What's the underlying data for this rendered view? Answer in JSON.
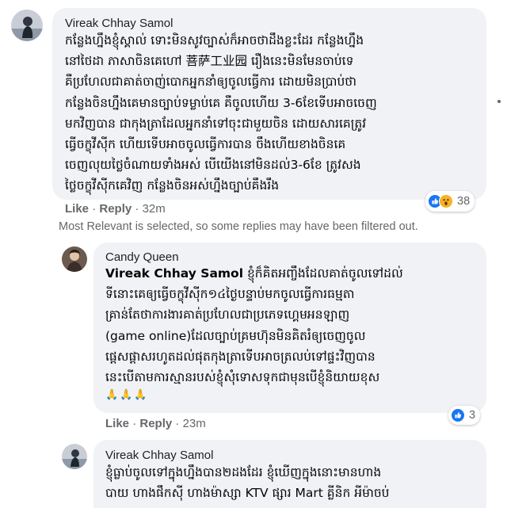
{
  "comments": [
    {
      "author": "Vireak Chhay Samol",
      "lines": [
        "កន្លែងហ្នឹងខ្ញុំស្គាល់ ទោះមិនសូវច្បាស់ក៏អាចថាដឹងខ្លះដែរ កន្លែងហ្នឹង",
        "នៅថៃដា ភាសាចិនគេហៅ 菩萨工业园 រឿងនេះមិនមែនចាប់ទេ",
        "គឺប្រហែលជាគាត់ចាញ់បោកអ្នកនាំឲ្យចូលធ្វើការ ដោយមិនប្រាប់ថា",
        "កន្លែងចិនហ្នឹងគេមានច្បាប់ទម្លាប់គេ គឺចូលហើយ 3-6ខែទើបអាចចេញ",
        "មកវិញបាន ជាកុងត្រាដែលអ្នកនាំទៅចុះជាមួយចិន ដោយសារគេត្រូវ",
        "ធ្វើចក្ខុវីស៊ីក ហើយទើបអាចចូលធ្វើការបាន ចឹងហើយខាងចិនគេ",
        "ចេញលុយថ្លៃចំណាយទាំងអស់ បើយើងនៅមិនដល់3-6ខែ ត្រូវសង",
        "ថ្លៃចក្ខុវីស៊ីកគេវិញ កន្លែងចិនអស់ហ្នឹងច្បាប់គឹងរឹង"
      ],
      "actions": {
        "like": "Like",
        "reply": "Reply",
        "time": "32m"
      },
      "reaction_count": "38",
      "reaction_icons": [
        "like-reaction-icon",
        "wow-reaction-icon"
      ]
    },
    {
      "author": "Candy Queen",
      "mention": "Vireak Chhay Samol",
      "first_line_rest": " ខ្ញុំក៏គិតអញ្ចឹងដែលគាត់ចូលទៅដល់",
      "lines": [
        "ទីនោះគេឲ្យធ្វើចក្ខុវីស៊ីក១៤ថ្ងៃបន្ទាប់មកចូលធ្វើការធម្មតា",
        "គ្រាន់តែថាការងារគាត់ប្រហែលជាប្រភេទហ្គេមអនឡាញ",
        "(game online)ដែលច្បាប់គ្រមហ៊ុនមិនគិតរំឲ្យចេញចូល",
        "ផ្ដេសផ្ដាសរហូតដល់ផុតកុងត្រាទើបអាចត្រលប់ទៅផ្ទះវិញបាន",
        "នេះបើតាមការស្មានរបស់ខ្ញុំសុំទោសទុកជាមុនបើខ្ញុំនិយាយខុស"
      ],
      "emoji": "🙏🙏🙏",
      "actions": {
        "like": "Like",
        "reply": "Reply",
        "time": "23m"
      },
      "reaction_count": "3",
      "reaction_icons": [
        "like-reaction-icon"
      ]
    },
    {
      "author": "Vireak Chhay Samol",
      "lines": [
        "ខ្ញុំធ្លាប់ចូលទៅក្នុងហ្នឹងបាន២ដងដែរ ខ្ញុំឃើញក្នុងនោះមានហាង",
        "បាយ ហាងផឹកស៊ី ហាងម៉ាស្សា KTV ផ្សារ Mart គ្លីនិក អីម៉ាចប់"
      ]
    }
  ],
  "filter_note": "Most Relevant is selected, so some replies may have been filtered out.",
  "colors": {
    "bubble": "#f0f2f5",
    "like_blue": "#1877f2",
    "wow_yellow": "#f7b125",
    "meta_gray": "#65676b"
  }
}
